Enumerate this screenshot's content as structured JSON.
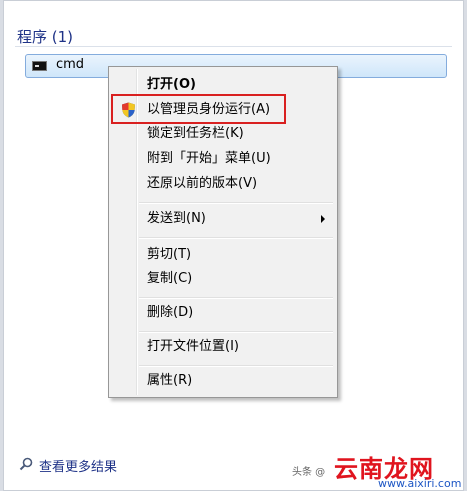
{
  "section": {
    "title": "程序 (1)"
  },
  "result": {
    "label": "cmd",
    "icon": "cmd-console-icon"
  },
  "context_menu": {
    "items": [
      {
        "label": "打开(O)",
        "bold": true
      },
      {
        "label": "以管理员身份运行(A)",
        "icon": "uac-shield-icon",
        "highlighted": true
      },
      {
        "label": "锁定到任务栏(K)"
      },
      {
        "label": "附到「开始」菜单(U)"
      },
      {
        "label": "还原以前的版本(V)"
      },
      {
        "label": "发送到(N)",
        "submenu": true
      },
      {
        "label": "剪切(T)"
      },
      {
        "label": "复制(C)"
      },
      {
        "label": "删除(D)"
      },
      {
        "label": "打开文件位置(I)"
      },
      {
        "label": "属性(R)"
      }
    ]
  },
  "footer": {
    "more_results": "查看更多结果",
    "icon": "search-icon"
  },
  "watermark": {
    "platform": "头条 @",
    "brand": "云南龙网",
    "url": "www.aixiri.com"
  },
  "colors": {
    "highlight_border": "#d92020",
    "link": "#1e3287",
    "brand": "#e0141e"
  }
}
